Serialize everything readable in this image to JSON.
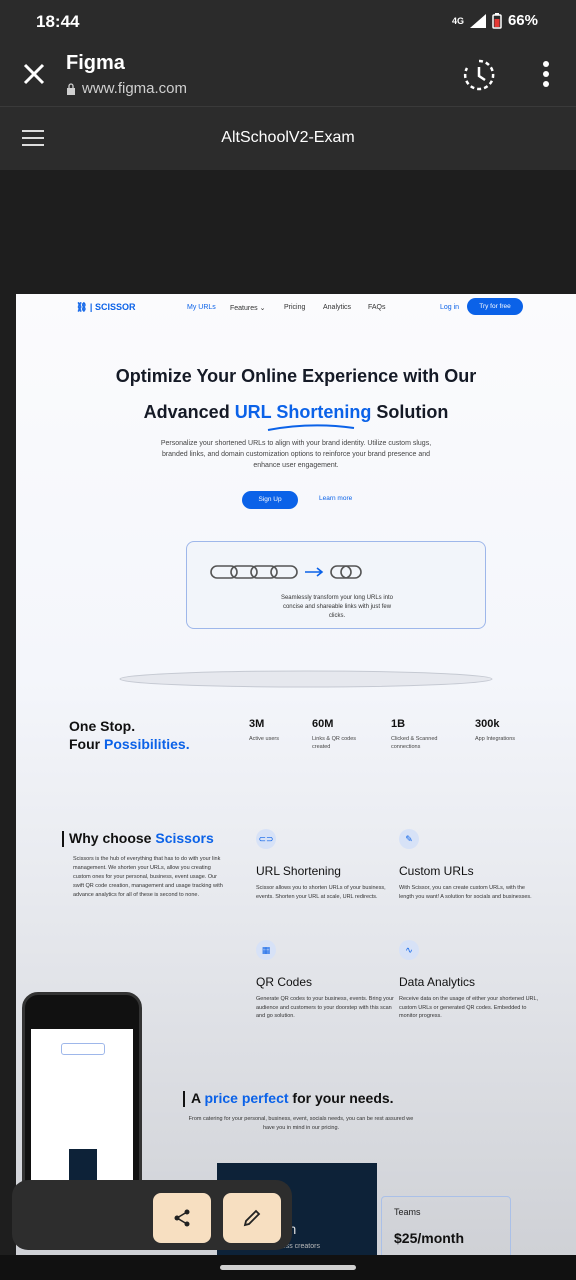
{
  "status": {
    "time": "18:44",
    "network": "4G",
    "battery": "66%"
  },
  "browser": {
    "title": "Figma",
    "url": "www.figma.com"
  },
  "figma": {
    "file_name": "AltSchoolV2-Exam"
  },
  "site": {
    "logo": "SCISSOR",
    "nav": [
      "My URLs",
      "Features",
      "Pricing",
      "Analytics",
      "FAQs"
    ],
    "login": "Log in",
    "try_free": "Try for free",
    "hero_line1": "Optimize Your Online Experience with Our",
    "hero_line2_pre": "Advanced ",
    "hero_line2_highlight": "URL Shortening",
    "hero_line2_post": " Solution",
    "hero_sub": "Personalize your shortened URLs to align with your brand identity. Utilize custom slugs, branded links, and domain customization options to reinforce your brand presence and enhance user engagement.",
    "sign_up": "Sign Up",
    "learn_more": "Learn more",
    "card_text": "Seamlessly transform your long URLs into concise and shareable links with just few clicks.",
    "stats_title1": "One Stop.",
    "stats_title2_pre": "Four ",
    "stats_title2_highlight": "Possibilities.",
    "stats": [
      {
        "value": "3M",
        "label": "Active users"
      },
      {
        "value": "60M",
        "label": "Links & QR codes created"
      },
      {
        "value": "1B",
        "label": "Clicked & Scanned connections"
      },
      {
        "value": "300k",
        "label": "App Integrations"
      }
    ],
    "why_pre": "Why choose ",
    "why_highlight": "Scissors",
    "why_body": "Scissors is the hub of everything that has to do with your link management. We shorten your URLs, allow you creating custom ones for your personal, business, event usage. Our swift QR code creation, management and usage tracking with advance analytics for all of these is second to none.",
    "features": [
      {
        "title": "URL Shortening",
        "body": "Scissor allows you to shorten URLs of your business, events. Shorten your URL at scale, URL redirects."
      },
      {
        "title": "Custom URLs",
        "body": "With Scissor, you can create custom URLs, with the length you want! A solution for socials and businesses."
      },
      {
        "title": "QR Codes",
        "body": "Generate QR codes to your business, events. Bring your audience and customers to your doorstep with this scan and go solution."
      },
      {
        "title": "Data Analytics",
        "body": "Receive data on the usage of either your shortened URL, custom URLs or generated QR codes. Embedded to monitor progress."
      }
    ],
    "price_pre": "A ",
    "price_highlight": "price perfect",
    "price_post": " for your needs.",
    "price_sub": "From catering for your personal, business, event, socials needs, you can be rest assured we have you in mind in our pricing.",
    "plan_dark_price": "onth",
    "plan_dark_sub": "usiness creators",
    "plan_team_title": "Teams",
    "plan_team_price": "$25/month"
  }
}
